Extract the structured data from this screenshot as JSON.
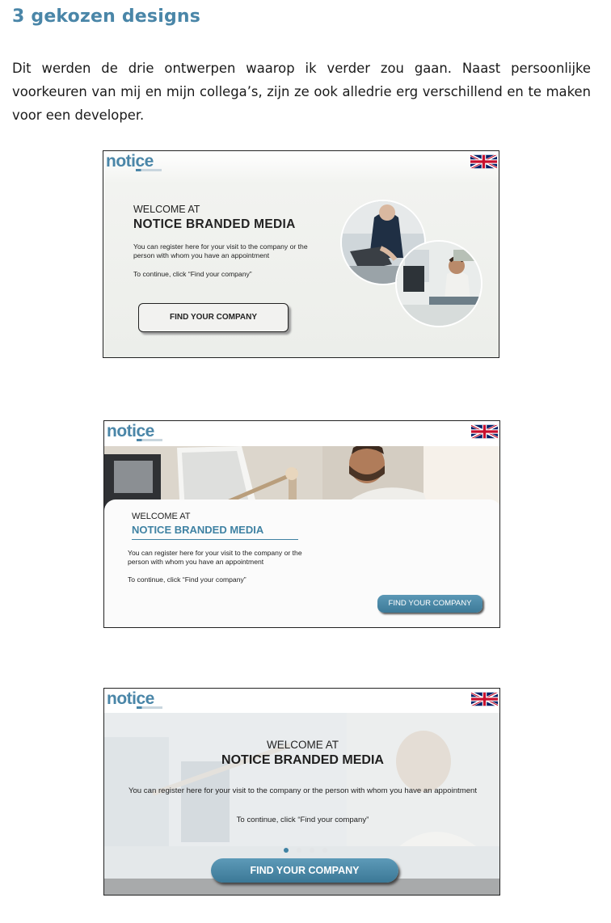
{
  "heading": "3 gekozen designs",
  "paragraph": "Dit werden de drie ontwerpen waarop ik verder zou gaan. Naast persoonlijke voorkeuren van mij en mijn collega’s, zijn ze ook alledrie erg verschillend en te maken voor een developer.",
  "colors": {
    "accent": "#4a86a8",
    "button_blue": "#3f82a3"
  },
  "designs": [
    {
      "logo": "notice",
      "welcome_line": "WELCOME AT",
      "brand_line": "NOTICE BRANDED MEDIA",
      "description": "You can register here for your visit to the company or the person with whom you have an appointment",
      "continue_text": "To continue, click “Find your company”",
      "button_label": "FIND YOUR COMPANY",
      "flag_icon": "uk-flag-icon"
    },
    {
      "logo": "notice",
      "welcome_line": "WELCOME AT",
      "brand_line": "NOTICE BRANDED MEDIA",
      "description": "You can register here for your visit to the company or the person with whom you have an appointment",
      "continue_text": "To continue, click “Find your company”",
      "button_label": "FIND YOUR COMPANY",
      "flag_icon": "uk-flag-icon"
    },
    {
      "logo": "notice",
      "welcome_line": "WELCOME AT",
      "brand_line": "NOTICE BRANDED MEDIA",
      "description": "You can register here for your visit to the company or the person with whom you have an appointment",
      "continue_text": "To continue, click “Find your company”",
      "button_label": "FIND YOUR COMPANY",
      "flag_icon": "uk-flag-icon"
    }
  ]
}
